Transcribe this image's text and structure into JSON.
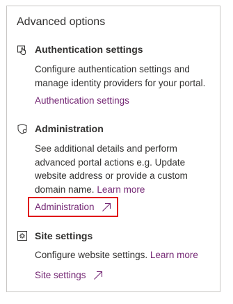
{
  "panel": {
    "title": "Advanced options"
  },
  "sections": {
    "authentication": {
      "icon": "hand-pointer-icon",
      "title": "Authentication settings",
      "description": "Configure authentication settings and manage identity providers for your portal.",
      "link_label": "Authentication settings"
    },
    "administration": {
      "icon": "shield-icon",
      "title": "Administration",
      "description": "See additional details and perform advanced portal actions e.g. Update website address or provide a custom domain name.",
      "learn_more": "Learn more",
      "link_label": "Administration",
      "link_icon": "external-arrow-icon"
    },
    "site_settings": {
      "icon": "gear-doc-icon",
      "title": "Site settings",
      "description": "Configure website settings.",
      "learn_more": "Learn more",
      "link_label": "Site settings",
      "link_icon": "external-arrow-icon"
    }
  },
  "colors": {
    "link": "#742774",
    "highlight": "#e00014",
    "border": "#c8c6c4",
    "text": "#323130"
  }
}
